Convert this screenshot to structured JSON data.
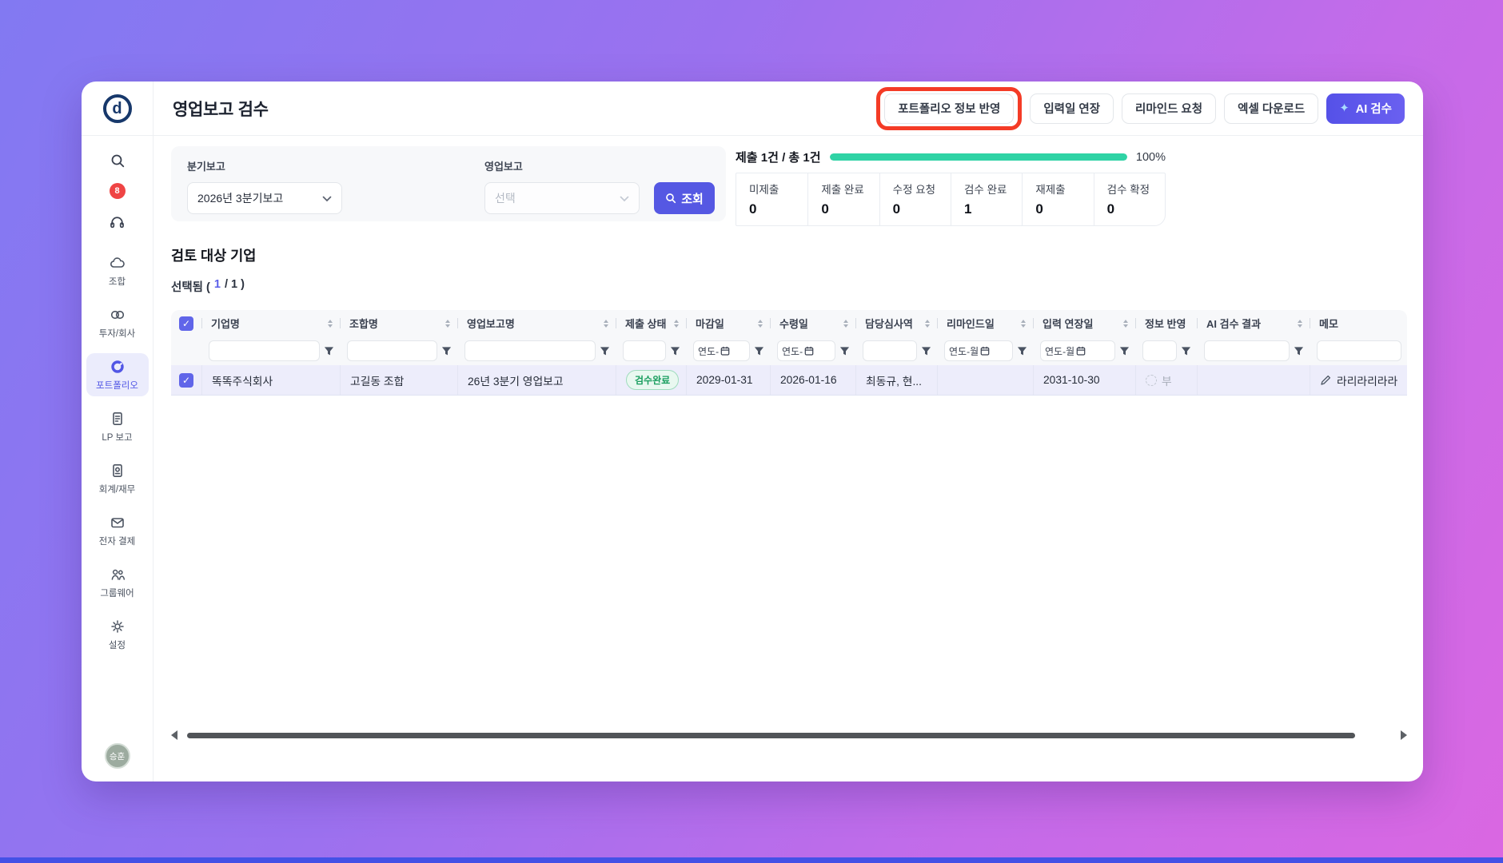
{
  "page": {
    "title": "영업보고 검수"
  },
  "topbar": {
    "portfolio_reflect": "포트폴리오 정보 반영",
    "extend_input": "입력일 연장",
    "remind_request": "리마인드 요청",
    "excel_download": "엑셀 다운로드",
    "ai_review": "AI 검수"
  },
  "sidebar": {
    "notification_count": "8",
    "items": [
      {
        "label": "조합"
      },
      {
        "label": "투자/회사"
      },
      {
        "label": "포트폴리오"
      },
      {
        "label": "LP 보고"
      },
      {
        "label": "회계/재무"
      },
      {
        "label": "전자 결제"
      },
      {
        "label": "그룹웨어"
      },
      {
        "label": "설정"
      }
    ],
    "user_name": "승훈"
  },
  "filters": {
    "quarter_label": "분기보고",
    "quarter_value": "2026년 3분기보고",
    "report_label": "영업보고",
    "report_placeholder": "선택",
    "search_button": "조회"
  },
  "progress": {
    "summary": "제출 1건 / 총 1건",
    "percent": "100%",
    "stats": [
      {
        "label": "미제출",
        "value": "0"
      },
      {
        "label": "제출 완료",
        "value": "0"
      },
      {
        "label": "수정 요청",
        "value": "0"
      },
      {
        "label": "검수 완료",
        "value": "1"
      },
      {
        "label": "재제출",
        "value": "0"
      },
      {
        "label": "검수 확정",
        "value": "0"
      }
    ]
  },
  "section": {
    "title": "검토 대상 기업",
    "selected_prefix": "선택됨 (",
    "selected_count": "1",
    "selected_suffix": "/ 1 )"
  },
  "table": {
    "columns": [
      "기업명",
      "조합명",
      "영업보고명",
      "제출 상태",
      "마감일",
      "수령일",
      "담당심사역",
      "리마인드일",
      "입력 연장일",
      "정보 반영",
      "AI 검수 결과",
      "메모"
    ],
    "date_filter_short": "연도-",
    "date_filter_month": "연도-월",
    "rows": [
      {
        "company": "똑똑주식회사",
        "fund": "고길동 조합",
        "report": "26년 3분기 영업보고",
        "status": "검수완료",
        "due_date": "2029-01-31",
        "received_date": "2026-01-16",
        "reviewers": "최동규, 현...",
        "remind_date": "",
        "extension_date": "2031-10-30",
        "info_reflect": "부",
        "ai_result": "",
        "memo": "라리라리라라"
      }
    ]
  },
  "colors": {
    "accent": "#5b5ae8",
    "progress_green": "#2fd3a5",
    "badge_green": "#1a9e5f",
    "highlight_red": "#f43b26"
  }
}
